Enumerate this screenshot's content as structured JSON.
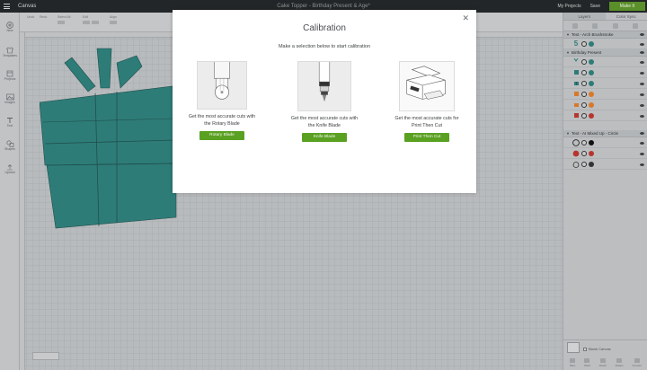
{
  "topbar": {
    "app_title": "Canvas",
    "doc_title": "Cake Topper - Birthday Present & Age*",
    "my_projects": "My Projects",
    "save": "Save",
    "make": "Make It"
  },
  "toolbar": {
    "undo": "Undo",
    "redo": "Redo",
    "select_all": "Select All",
    "edit": "Edit",
    "align": "Align"
  },
  "leftbar": {
    "items": [
      {
        "label": "New",
        "icon": "plus-icon"
      },
      {
        "label": "Templates",
        "icon": "shirt-icon"
      },
      {
        "label": "Projects",
        "icon": "projects-icon"
      },
      {
        "label": "Images",
        "icon": "image-icon"
      },
      {
        "label": "Text",
        "icon": "text-icon"
      },
      {
        "label": "Shapes",
        "icon": "shapes-icon"
      },
      {
        "label": "Upload",
        "icon": "upload-icon"
      }
    ]
  },
  "rightpanel": {
    "tabs": [
      "Layers",
      "Color Sync"
    ],
    "groups": [
      {
        "name": "Text - Arch Brushstroke",
        "rows": [
          {
            "thumb": "5",
            "color": "#2e7c78"
          }
        ]
      },
      {
        "name": "Birthday Present",
        "rows": [
          {
            "color": "#2e7c78"
          },
          {
            "color": "#2e7c78"
          },
          {
            "color": "#2e7c78"
          },
          {
            "color": "#d7792a"
          },
          {
            "color": "#d7792a"
          },
          {
            "color": "#b7352e"
          }
        ]
      },
      {
        "name": "Text - AI Mixed Up - Circle",
        "rows": [
          {
            "color": "#111111"
          },
          {
            "color": "#b7352e"
          },
          {
            "color": "#333333"
          }
        ]
      }
    ],
    "blank_canvas": "Blank Canvas",
    "actions": [
      "Slice",
      "Weld",
      "Attach",
      "Flatten",
      "Contour"
    ]
  },
  "modal": {
    "title": "Calibration",
    "subtitle": "Make a selection below to start calibration",
    "options": [
      {
        "line1": "Get the most accurate cuts with",
        "line2": "the Rotary Blade",
        "button": "Rotary Blade"
      },
      {
        "line1": "Get the most accurate cuts with",
        "line2": "the Knife Blade",
        "button": "Knife Blade"
      },
      {
        "line1": "Get the most accurate cuts for",
        "line2": "Print Then Cut",
        "button": "Print Then Cut"
      }
    ]
  },
  "colors": {
    "accent_green": "#5aa021",
    "gift_teal": "#2e7c78"
  }
}
